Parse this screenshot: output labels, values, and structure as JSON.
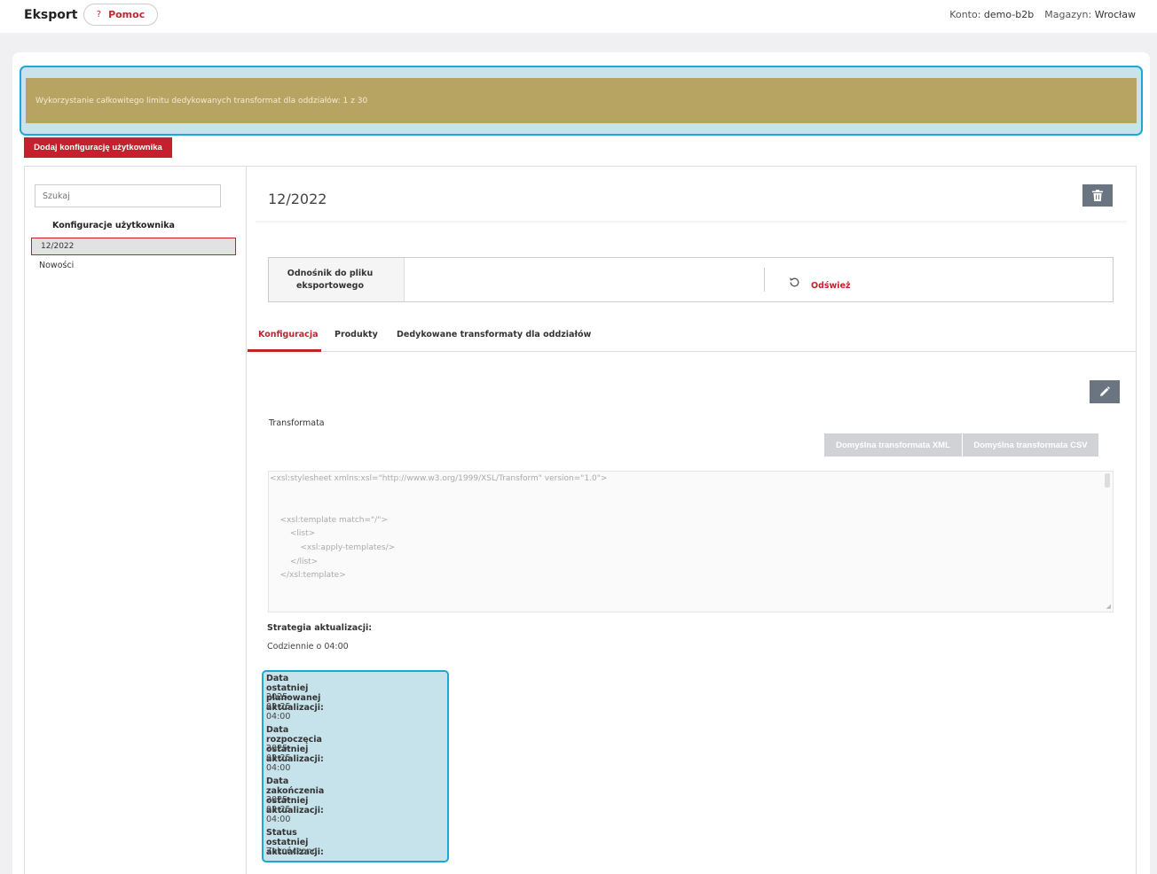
{
  "header": {
    "title": "Eksport",
    "help_icon": "?",
    "help_label": "Pomoc",
    "account_label": "Konto:",
    "account_value": "demo-b2b",
    "warehouse_label": "Magazyn:",
    "warehouse_value": "Wrocław"
  },
  "limit": {
    "text": "Wykorzystanie całkowitego limitu dedykowanych transformat dla oddziałów: 1 z 30"
  },
  "add_button": "Dodaj konfigurację użytkownika",
  "sidebar": {
    "search_placeholder": "Szukaj",
    "group_title": "Konfiguracje użytkownika",
    "items": [
      {
        "label": "12/2022",
        "selected": true
      },
      {
        "label": "Nowości",
        "selected": false
      }
    ]
  },
  "main": {
    "title": "12/2022",
    "link_label": "Odnośnik do pliku eksportowego",
    "refresh_label": "Odśwież",
    "tabs": [
      {
        "label": "Konfiguracja",
        "active": true
      },
      {
        "label": "Produkty",
        "active": false
      },
      {
        "label": "Dedykowane transformaty dla oddziałów",
        "active": false
      }
    ],
    "transform_label": "Transformata",
    "btn_xml": "Domyślna transformata XML",
    "btn_csv": "Domyślna transformata CSV",
    "code": "<xsl:stylesheet xmlns:xsl=\"http://www.w3.org/1999/XSL/Transform\" version=\"1.0\">\n\n\n    <xsl:template match=\"/\">\n        <list>\n            <xsl:apply-templates/>\n        </list>\n    </xsl:template>\n\n\n    <xsl:template match=\"product\">",
    "strategy_label": "Strategia aktualizacji:",
    "strategy_value": "Codziennie o 04:00",
    "last_planned_label": "Data ostatniej planowanej aktualizacji:",
    "last_planned_value": "2025-03-25 04:00",
    "start_label": "Data rozpoczęcia ostatniej aktualizacji:",
    "start_value": "2025-03-25 04:00",
    "end_label": "Data zakończenia ostatniej aktualizacji:",
    "end_value": "2025-03-25 04:00",
    "status_label": "Status ostatniej aktualizacji:",
    "status_value": "Zakończono"
  },
  "colors": {
    "accent": "#c4202d",
    "limit_bar": "#b7a362",
    "highlight": "#1fa6d9"
  },
  "icons": {
    "help": "question-icon",
    "delete": "trash-icon",
    "edit": "pencil-icon",
    "refresh": "refresh-icon"
  }
}
